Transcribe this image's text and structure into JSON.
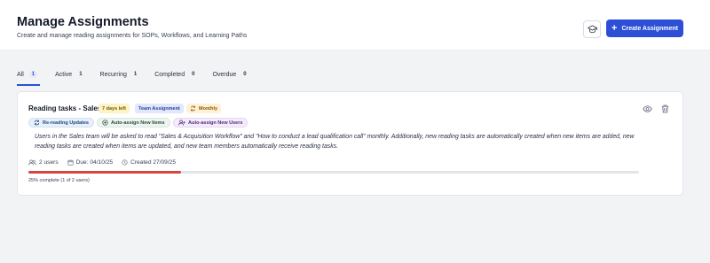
{
  "header": {
    "title": "Manage Assignments",
    "subtitle": "Create and manage reading assignments for SOPs, Workflows, and Learning Paths",
    "create_button_label": "Create Assignment",
    "create_button_icon": "plus-icon",
    "secondary_button_icon": "graduation-cap-icon",
    "accent_color": "#2d4fd6"
  },
  "tabs": [
    {
      "label": "All",
      "count": "1",
      "active": true
    },
    {
      "label": "Active",
      "count": "1",
      "active": false
    },
    {
      "label": "Recurring",
      "count": "1",
      "active": false
    },
    {
      "label": "Completed",
      "count": "0",
      "active": false
    },
    {
      "label": "Overdue",
      "count": "0",
      "active": false
    }
  ],
  "assignment": {
    "title": "Reading tasks - Sales",
    "badges": {
      "days_left": "7 days left",
      "type": "Team Assignment",
      "recurrence": "Monthly"
    },
    "pills": {
      "rereading": "Re-reading Updates",
      "auto_items": "Auto-assign New Items",
      "auto_users": "Auto-assign New Users"
    },
    "description": "Users in the Sales team will be asked to read \"Sales & Acquisition Workflow\" and \"How to conduct a lead qualification call\" monthly. Additionally, new reading tasks are automatically created when new items are added, new reading tasks are created when items are updated, and new team members automatically receive reading tasks.",
    "meta": {
      "users": "2 users",
      "due": "Due: 04/10/25",
      "created": "Created 27/09/25"
    },
    "progress": {
      "fraction": 0.25,
      "label": "25% complete (1 of 2 users)",
      "color": "#d6453e"
    },
    "actions": {
      "view_icon": "eye-icon",
      "delete_icon": "trash-icon"
    }
  }
}
